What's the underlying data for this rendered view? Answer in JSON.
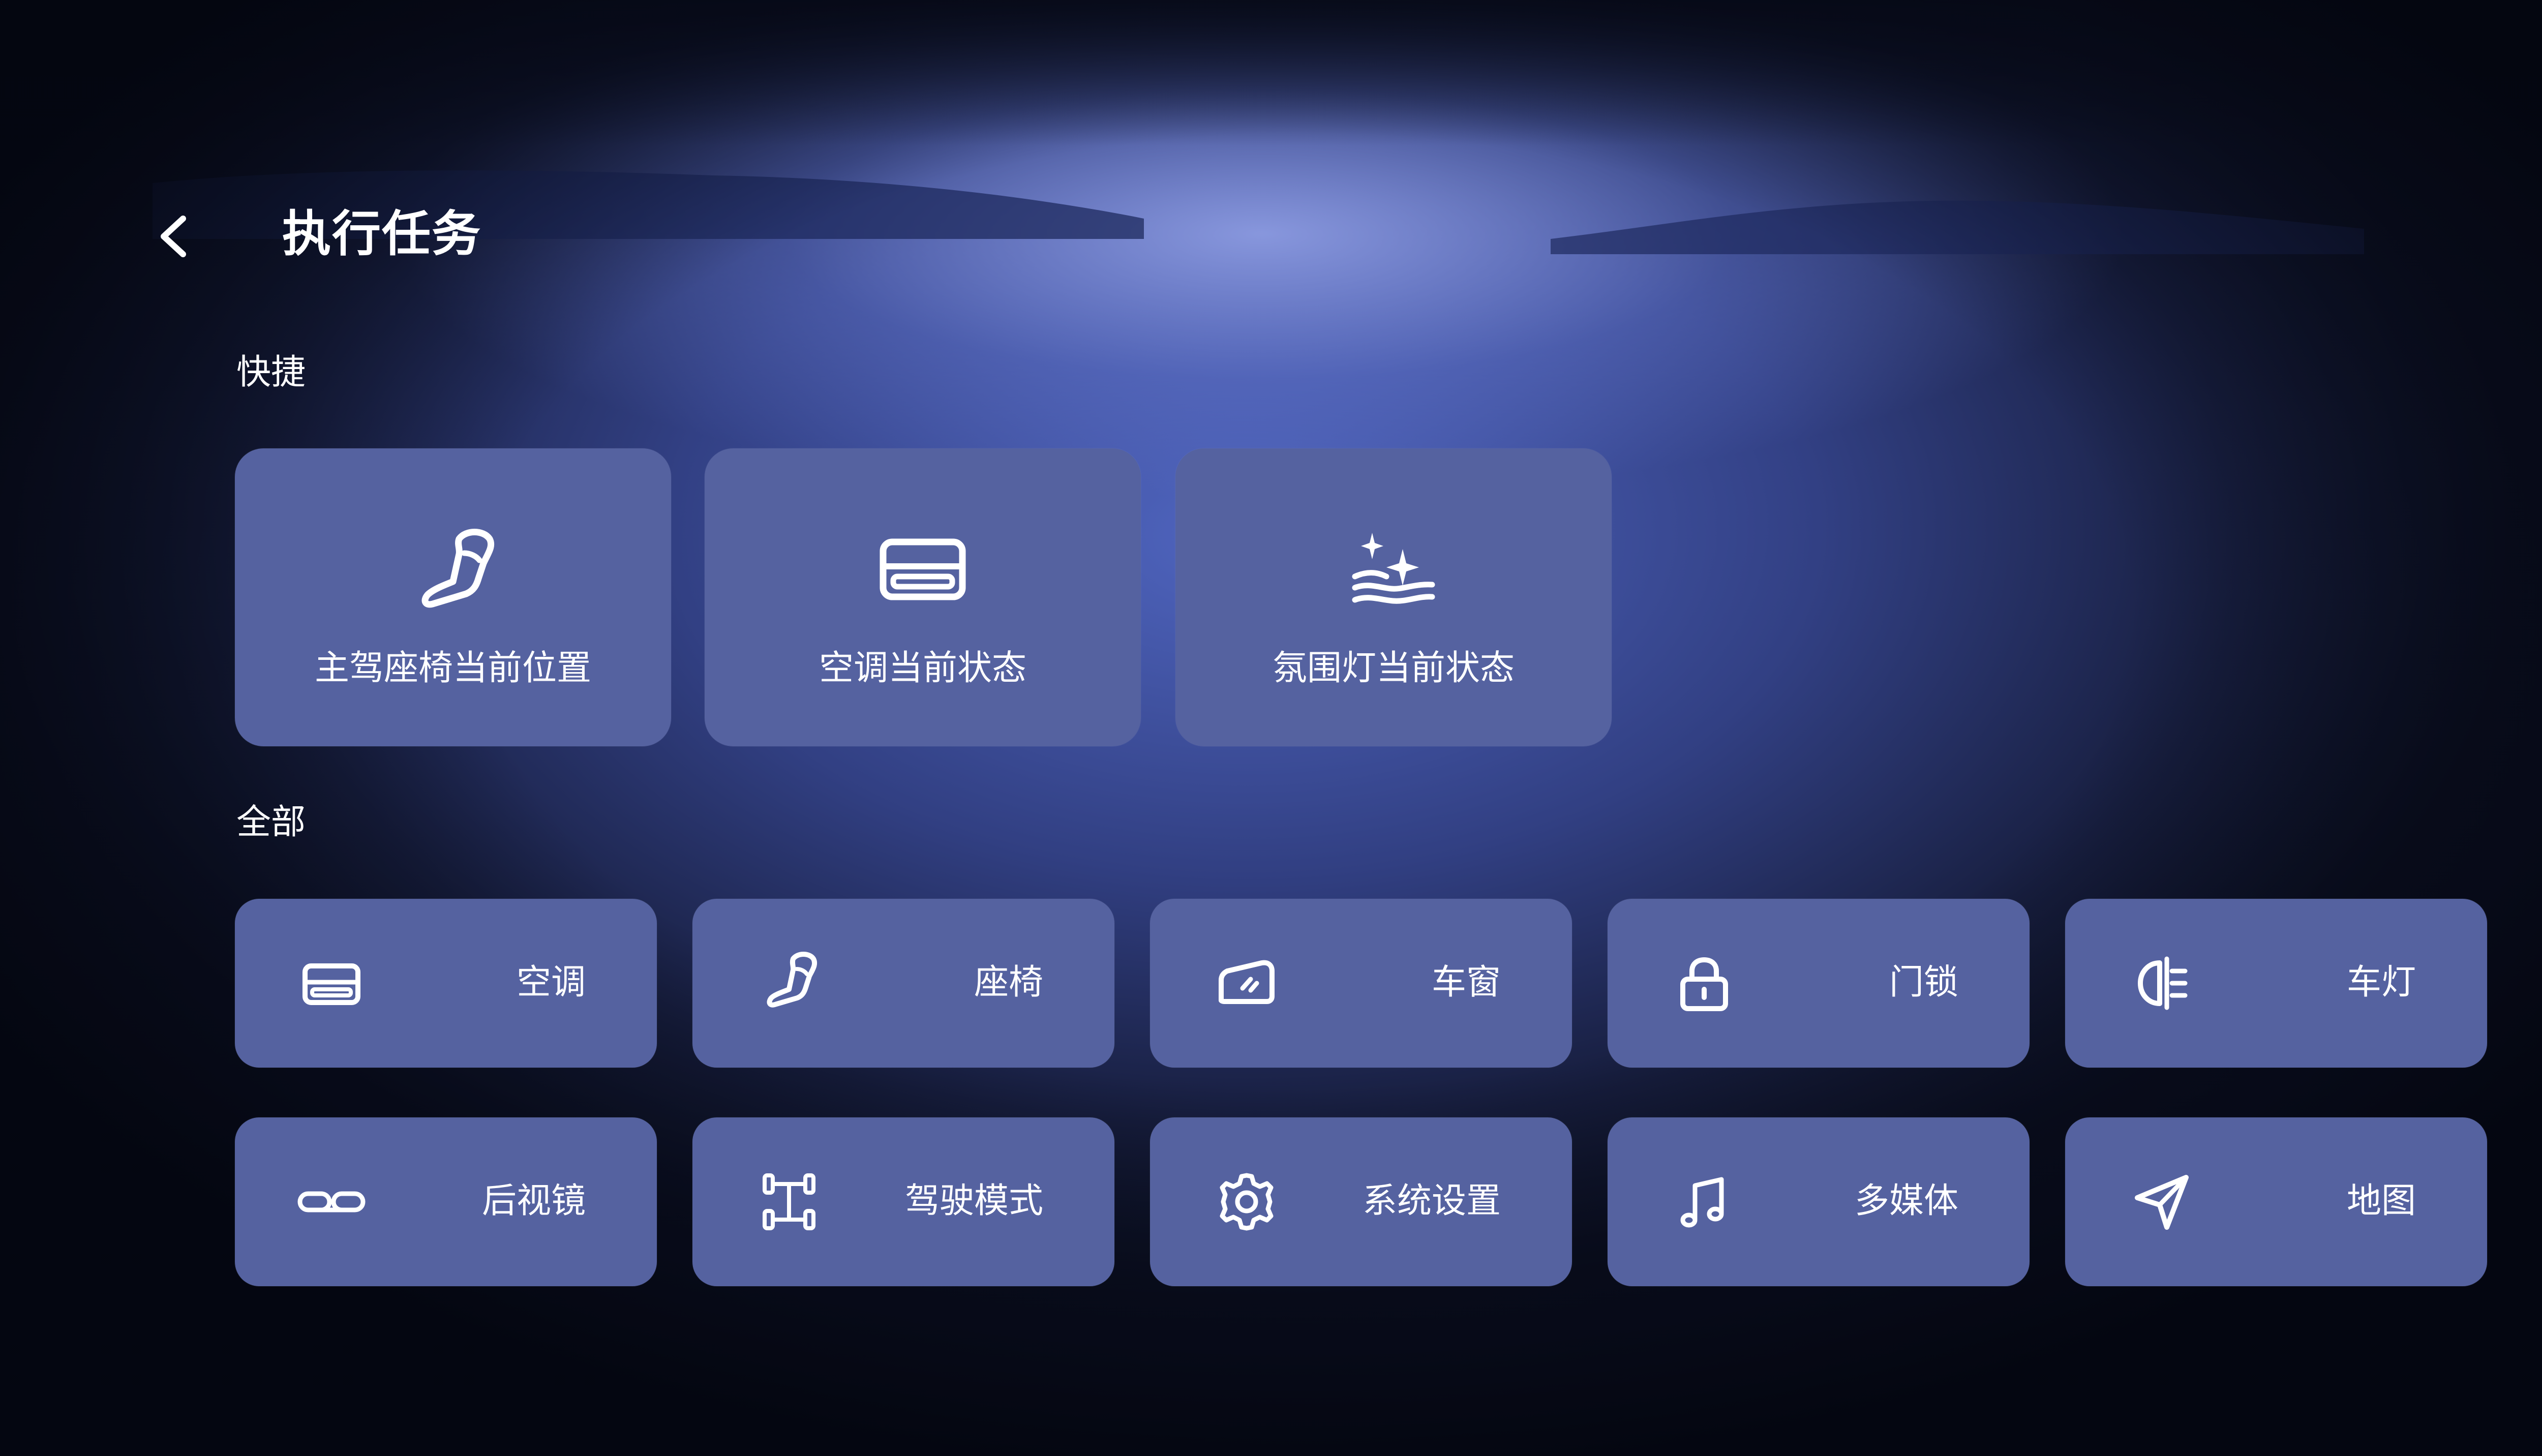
{
  "header": {
    "title": "执行任务",
    "back_icon": "chevron-left-icon"
  },
  "sections": {
    "quick_label": "快捷",
    "all_label": "全部"
  },
  "quick": [
    {
      "label": "主驾座椅当前位置",
      "icon": "seat-icon"
    },
    {
      "label": "空调当前状态",
      "icon": "air-conditioner-icon"
    },
    {
      "label": "氛围灯当前状态",
      "icon": "ambient-light-icon"
    }
  ],
  "all": [
    {
      "label": "空调",
      "icon": "air-conditioner-icon"
    },
    {
      "label": "座椅",
      "icon": "seat-icon"
    },
    {
      "label": "车窗",
      "icon": "car-window-icon"
    },
    {
      "label": "门锁",
      "icon": "lock-icon"
    },
    {
      "label": "车灯",
      "icon": "headlight-icon"
    },
    {
      "label": "后视镜",
      "icon": "mirror-icon"
    },
    {
      "label": "驾驶模式",
      "icon": "drive-mode-icon"
    },
    {
      "label": "系统设置",
      "icon": "gear-icon"
    },
    {
      "label": "多媒体",
      "icon": "music-note-icon"
    },
    {
      "label": "地图",
      "icon": "navigation-icon"
    }
  ],
  "colors": {
    "tile": "#5562a0",
    "text": "#ffffff"
  }
}
